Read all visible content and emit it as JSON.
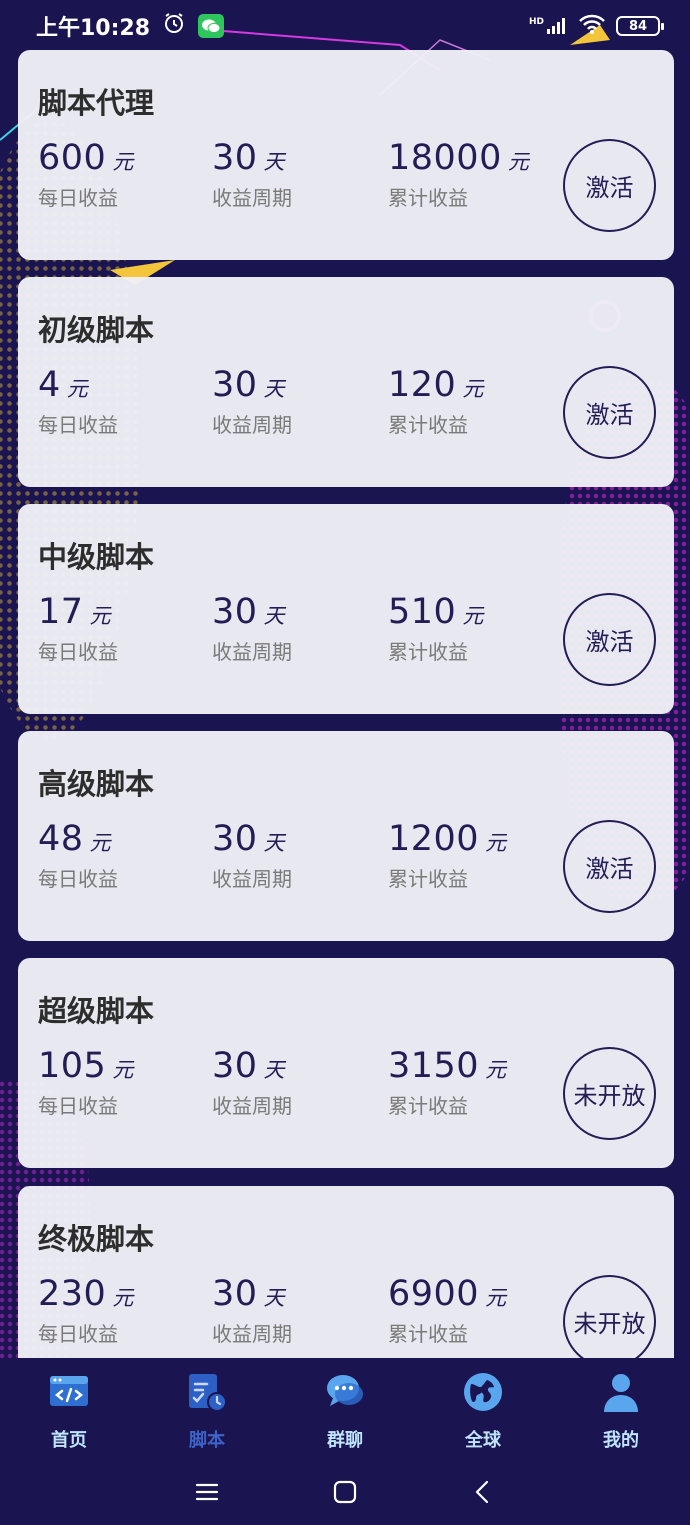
{
  "status_bar": {
    "time": "上午10:28",
    "network": "HD",
    "battery": "84"
  },
  "cards": [
    {
      "title": "脚本代理",
      "daily": "600",
      "daily_unit": "元",
      "daily_label": "每日收益",
      "period": "30",
      "period_unit": "天",
      "period_label": "收益周期",
      "total": "18000",
      "total_unit": "元",
      "total_label": "累计收益",
      "button": "激活"
    },
    {
      "title": "初级脚本",
      "daily": "4",
      "daily_unit": "元",
      "daily_label": "每日收益",
      "period": "30",
      "period_unit": "天",
      "period_label": "收益周期",
      "total": "120",
      "total_unit": "元",
      "total_label": "累计收益",
      "button": "激活"
    },
    {
      "title": "中级脚本",
      "daily": "17",
      "daily_unit": "元",
      "daily_label": "每日收益",
      "period": "30",
      "period_unit": "天",
      "period_label": "收益周期",
      "total": "510",
      "total_unit": "元",
      "total_label": "累计收益",
      "button": "激活"
    },
    {
      "title": "高级脚本",
      "daily": "48",
      "daily_unit": "元",
      "daily_label": "每日收益",
      "period": "30",
      "period_unit": "天",
      "period_label": "收益周期",
      "total": "1200",
      "total_unit": "元",
      "total_label": "累计收益",
      "button": "激活"
    },
    {
      "title": "超级脚本",
      "daily": "105",
      "daily_unit": "元",
      "daily_label": "每日收益",
      "period": "30",
      "period_unit": "天",
      "period_label": "收益周期",
      "total": "3150",
      "total_unit": "元",
      "total_label": "累计收益",
      "button": "未开放"
    },
    {
      "title": "终极脚本",
      "daily": "230",
      "daily_unit": "元",
      "daily_label": "每日收益",
      "period": "30",
      "period_unit": "天",
      "period_label": "收益周期",
      "total": "6900",
      "total_unit": "元",
      "total_label": "累计收益",
      "button": "未开放"
    }
  ],
  "bottom_nav": [
    {
      "label": "首页",
      "icon": "browser-code-icon",
      "active": false
    },
    {
      "label": "脚本",
      "icon": "script-clock-icon",
      "active": true
    },
    {
      "label": "群聊",
      "icon": "chat-bubbles-icon",
      "active": false
    },
    {
      "label": "全球",
      "icon": "globe-icon",
      "active": false
    },
    {
      "label": "我的",
      "icon": "user-icon",
      "active": false
    }
  ],
  "colors": {
    "background": "#1a1450",
    "card": "#f0f0f6",
    "accent": "#231d55",
    "nav_label": "#bfe4ff",
    "nav_active": "#3e63c7"
  }
}
